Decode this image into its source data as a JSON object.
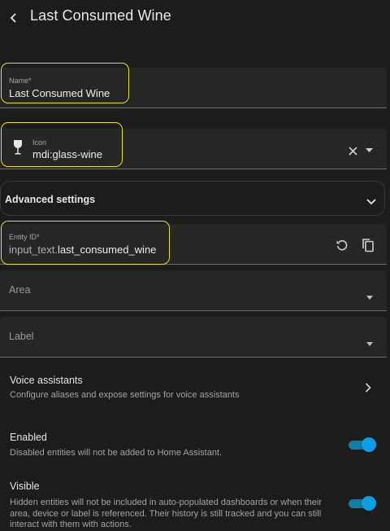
{
  "header": {
    "title": "Last Consumed Wine",
    "back_icon": "chevron-left-icon"
  },
  "name_field": {
    "label": "Name*",
    "value": "Last Consumed Wine"
  },
  "icon_field": {
    "label": "Icon",
    "value": "mdi:glass-wine",
    "icon": "glass-wine-icon"
  },
  "advanced": {
    "label": "Advanced settings",
    "expanded": false
  },
  "entity_id_field": {
    "label": "Entity ID*",
    "prefix": "input_text.",
    "value": "last_consumed_wine"
  },
  "area_select": {
    "label": "Area"
  },
  "label_select": {
    "label": "Label"
  },
  "voice_assistants": {
    "title": "Voice assistants",
    "description": "Configure aliases and expose settings for voice assistants"
  },
  "enabled": {
    "title": "Enabled",
    "description": "Disabled entities will not be added to Home Assistant.",
    "on": true
  },
  "visible": {
    "title": "Visible",
    "description_lines": [
      "Hidden entities will not be included in auto-populated dashboards or when their",
      "area, device or label is referenced. Their history is still tracked and you can still",
      "interact with them with actions."
    ],
    "on": true
  },
  "colors": {
    "accent": "#0a9ee6",
    "highlight": "#e6e21a",
    "background": "#1c1c1c"
  }
}
